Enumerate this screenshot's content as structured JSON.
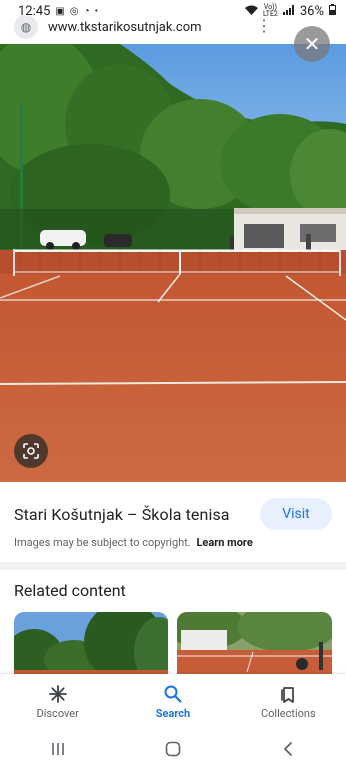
{
  "status_bar": {
    "time": "12:45",
    "volte_top": "Vo))",
    "volte_bottom": "LTE2",
    "battery": "36%",
    "notification_icons": [
      "image-icon",
      "messenger-icon",
      "chat-icon",
      "dot-icon"
    ]
  },
  "url_bar": {
    "text": "www.tkstarikosutnjak.com"
  },
  "hero": {
    "close_label": "✕",
    "lens_icon": "google-lens-icon"
  },
  "result": {
    "title": "Stari Košutnjak – Škola tenisa",
    "visit_label": "Visit",
    "copyright_text": "Images may be subject to copyright.",
    "learn_more_label": "Learn more"
  },
  "related": {
    "title": "Related content"
  },
  "bottom_nav": {
    "items": [
      {
        "label": "Discover",
        "icon": "asterisk-icon",
        "active": false
      },
      {
        "label": "Search",
        "icon": "search-icon",
        "active": true
      },
      {
        "label": "Collections",
        "icon": "bookmarks-icon",
        "active": false
      }
    ]
  },
  "colors": {
    "accent": "#1a73e8",
    "clay": "#c85a34",
    "text": "#202124",
    "muted": "#5f6368"
  }
}
